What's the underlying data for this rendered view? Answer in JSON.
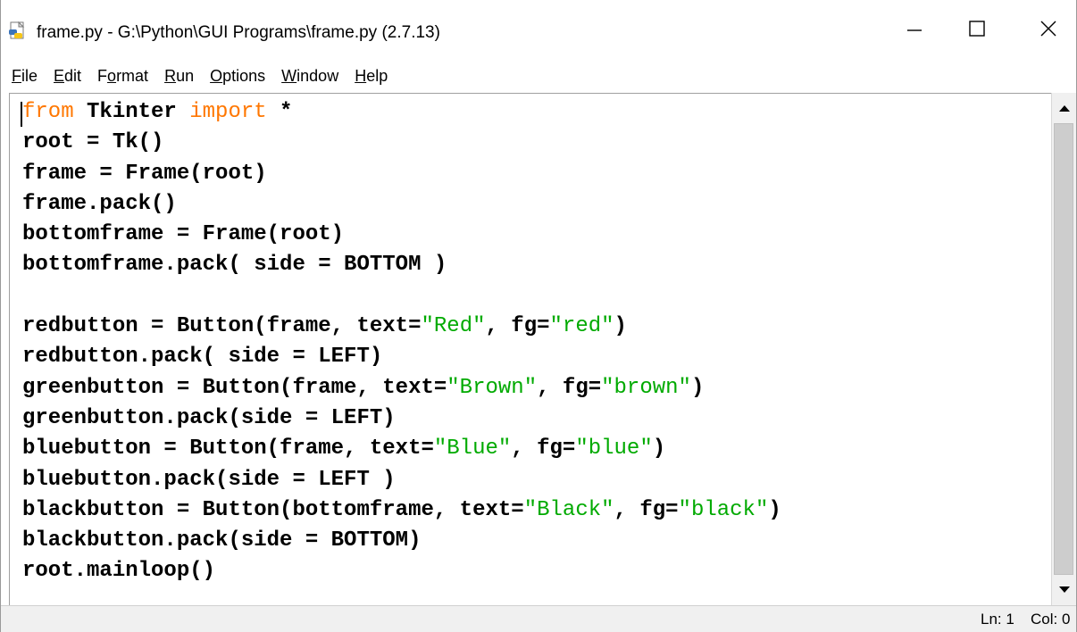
{
  "window": {
    "title": "frame.py - G:\\Python\\GUI Programs\\frame.py (2.7.13)",
    "icon": "python-file-icon",
    "controls": {
      "minimize_icon": "minimize-icon",
      "maximize_icon": "maximize-icon",
      "close_icon": "close-icon"
    }
  },
  "menu": {
    "items": [
      {
        "pre": "",
        "key": "F",
        "post": "ile"
      },
      {
        "pre": "",
        "key": "E",
        "post": "dit"
      },
      {
        "pre": "F",
        "key": "o",
        "post": "rmat"
      },
      {
        "pre": "",
        "key": "R",
        "post": "un"
      },
      {
        "pre": "",
        "key": "O",
        "post": "ptions"
      },
      {
        "pre": "",
        "key": "W",
        "post": "indow"
      },
      {
        "pre": "",
        "key": "H",
        "post": "elp"
      }
    ]
  },
  "editor": {
    "lines": [
      [
        {
          "t": "from",
          "c": "kw"
        },
        {
          "t": " Tkinter ",
          "c": ""
        },
        {
          "t": "import",
          "c": "kw"
        },
        {
          "t": " *",
          "c": ""
        }
      ],
      [
        {
          "t": "root = Tk()",
          "c": ""
        }
      ],
      [
        {
          "t": "frame = Frame(root)",
          "c": ""
        }
      ],
      [
        {
          "t": "frame.pack()",
          "c": ""
        }
      ],
      [
        {
          "t": "bottomframe = Frame(root)",
          "c": ""
        }
      ],
      [
        {
          "t": "bottomframe.pack( side = BOTTOM )",
          "c": ""
        }
      ],
      [
        {
          "t": "",
          "c": ""
        }
      ],
      [
        {
          "t": "redbutton = Button(frame, text=",
          "c": ""
        },
        {
          "t": "\"Red\"",
          "c": "str"
        },
        {
          "t": ", fg=",
          "c": ""
        },
        {
          "t": "\"red\"",
          "c": "str"
        },
        {
          "t": ")",
          "c": ""
        }
      ],
      [
        {
          "t": "redbutton.pack( side = LEFT)",
          "c": ""
        }
      ],
      [
        {
          "t": "greenbutton = Button(frame, text=",
          "c": ""
        },
        {
          "t": "\"Brown\"",
          "c": "str"
        },
        {
          "t": ", fg=",
          "c": ""
        },
        {
          "t": "\"brown\"",
          "c": "str"
        },
        {
          "t": ")",
          "c": ""
        }
      ],
      [
        {
          "t": "greenbutton.pack(side = LEFT)",
          "c": ""
        }
      ],
      [
        {
          "t": "bluebutton = Button(frame, text=",
          "c": ""
        },
        {
          "t": "\"Blue\"",
          "c": "str"
        },
        {
          "t": ", fg=",
          "c": ""
        },
        {
          "t": "\"blue\"",
          "c": "str"
        },
        {
          "t": ")",
          "c": ""
        }
      ],
      [
        {
          "t": "bluebutton.pack(side = LEFT )",
          "c": ""
        }
      ],
      [
        {
          "t": "blackbutton = Button(bottomframe, text=",
          "c": ""
        },
        {
          "t": "\"Black\"",
          "c": "str"
        },
        {
          "t": ", fg=",
          "c": ""
        },
        {
          "t": "\"black\"",
          "c": "str"
        },
        {
          "t": ")",
          "c": ""
        }
      ],
      [
        {
          "t": "blackbutton.pack(side = BOTTOM)",
          "c": ""
        }
      ],
      [
        {
          "t": "root.mainloop()",
          "c": ""
        }
      ]
    ],
    "colors": {
      "keyword": "#ff7700",
      "string": "#00aa00",
      "default": "#000000"
    }
  },
  "scrollbar": {
    "up_icon": "scroll-up-arrow-icon",
    "down_icon": "scroll-down-arrow-icon"
  },
  "status": {
    "line": "Ln: 1",
    "column": "Col: 0"
  }
}
